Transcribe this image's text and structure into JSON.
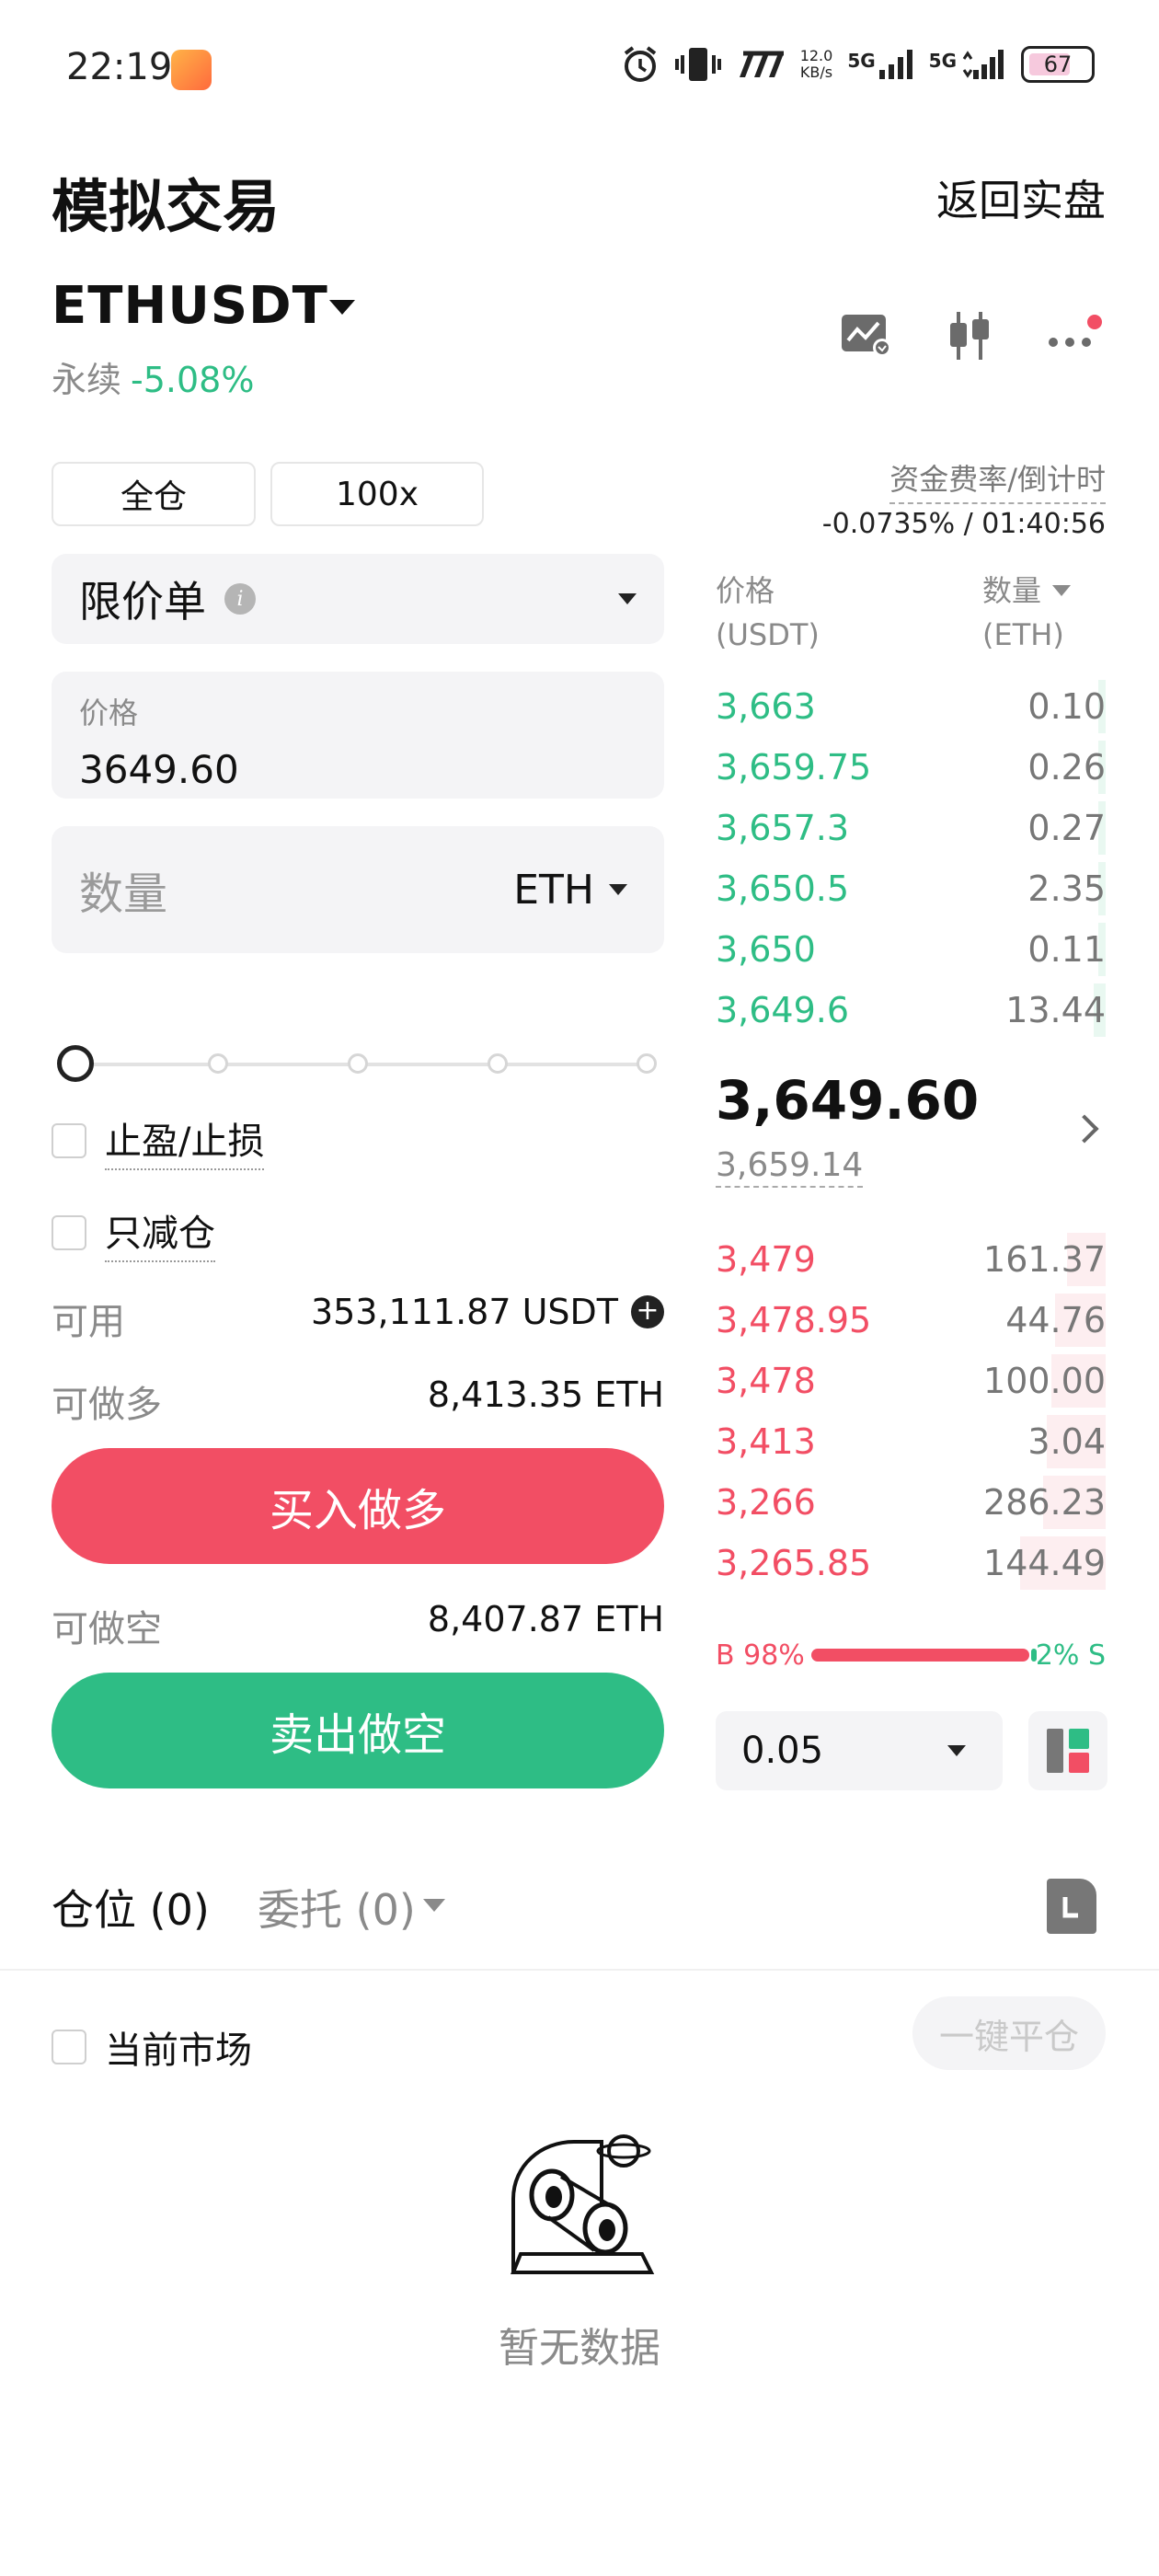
{
  "status_bar": {
    "time": "22:19",
    "net_speed": "12.0",
    "net_unit": "KB/s",
    "sig1": "5G",
    "sig2": "5G",
    "battery": "67"
  },
  "header": {
    "title": "模拟交易",
    "back_label": "返回实盘"
  },
  "instrument": {
    "pair": "ETHUSDT",
    "type": "永续",
    "change": "-5.08%"
  },
  "margin_mode": "全仓",
  "leverage": "100x",
  "funding": {
    "label": "资金费率/倒计时",
    "value": "-0.0735% / 01:40:56"
  },
  "order_form": {
    "order_type": "限价单",
    "price_label": "价格",
    "price_value": "3649.60",
    "qty_label": "数量",
    "qty_unit": "ETH",
    "slider_level": 0,
    "tp_sl_label": "止盈/止损",
    "reduce_only_label": "只减仓",
    "available_label": "可用",
    "available_value": "353,111.87 USDT",
    "long_label": "可做多",
    "long_value": "8,413.35 ETH",
    "buy_label": "买入做多",
    "short_label": "可做空",
    "short_value": "8,407.87 ETH",
    "sell_label": "卖出做空"
  },
  "order_book": {
    "price_header": "价格",
    "price_unit": "(USDT)",
    "qty_header": "数量",
    "qty_unit": "(ETH)",
    "asks": [
      {
        "price": "3,663",
        "qty": "0.10",
        "depth": 0.02
      },
      {
        "price": "3,659.75",
        "qty": "0.26",
        "depth": 0.02
      },
      {
        "price": "3,657.3",
        "qty": "0.27",
        "depth": 0.02
      },
      {
        "price": "3,650.5",
        "qty": "2.35",
        "depth": 0.02
      },
      {
        "price": "3,650",
        "qty": "0.11",
        "depth": 0.02
      },
      {
        "price": "3,649.6",
        "qty": "13.44",
        "depth": 0.03
      }
    ],
    "last_price": "3,649.60",
    "mark_price": "3,659.14",
    "bids": [
      {
        "price": "3,479",
        "qty": "161.37",
        "depth": 0.1
      },
      {
        "price": "3,478.95",
        "qty": "44.76",
        "depth": 0.13
      },
      {
        "price": "3,478",
        "qty": "100.00",
        "depth": 0.14
      },
      {
        "price": "3,413",
        "qty": "3.04",
        "depth": 0.15
      },
      {
        "price": "3,266",
        "qty": "286.23",
        "depth": 0.16
      },
      {
        "price": "3,265.85",
        "qty": "144.49",
        "depth": 0.22
      }
    ],
    "buy_ratio_label": "B 98%",
    "sell_ratio_label": "2% S",
    "buy_ratio": 0.98,
    "step": "0.05"
  },
  "tabs": {
    "positions": "仓位 (0)",
    "orders": "委托 (0)"
  },
  "filter": {
    "current_market": "当前市场",
    "close_all": "一键平仓"
  },
  "empty_text": "暂无数据",
  "colors": {
    "buy": "#f24e64",
    "sell": "#2ebd85"
  }
}
